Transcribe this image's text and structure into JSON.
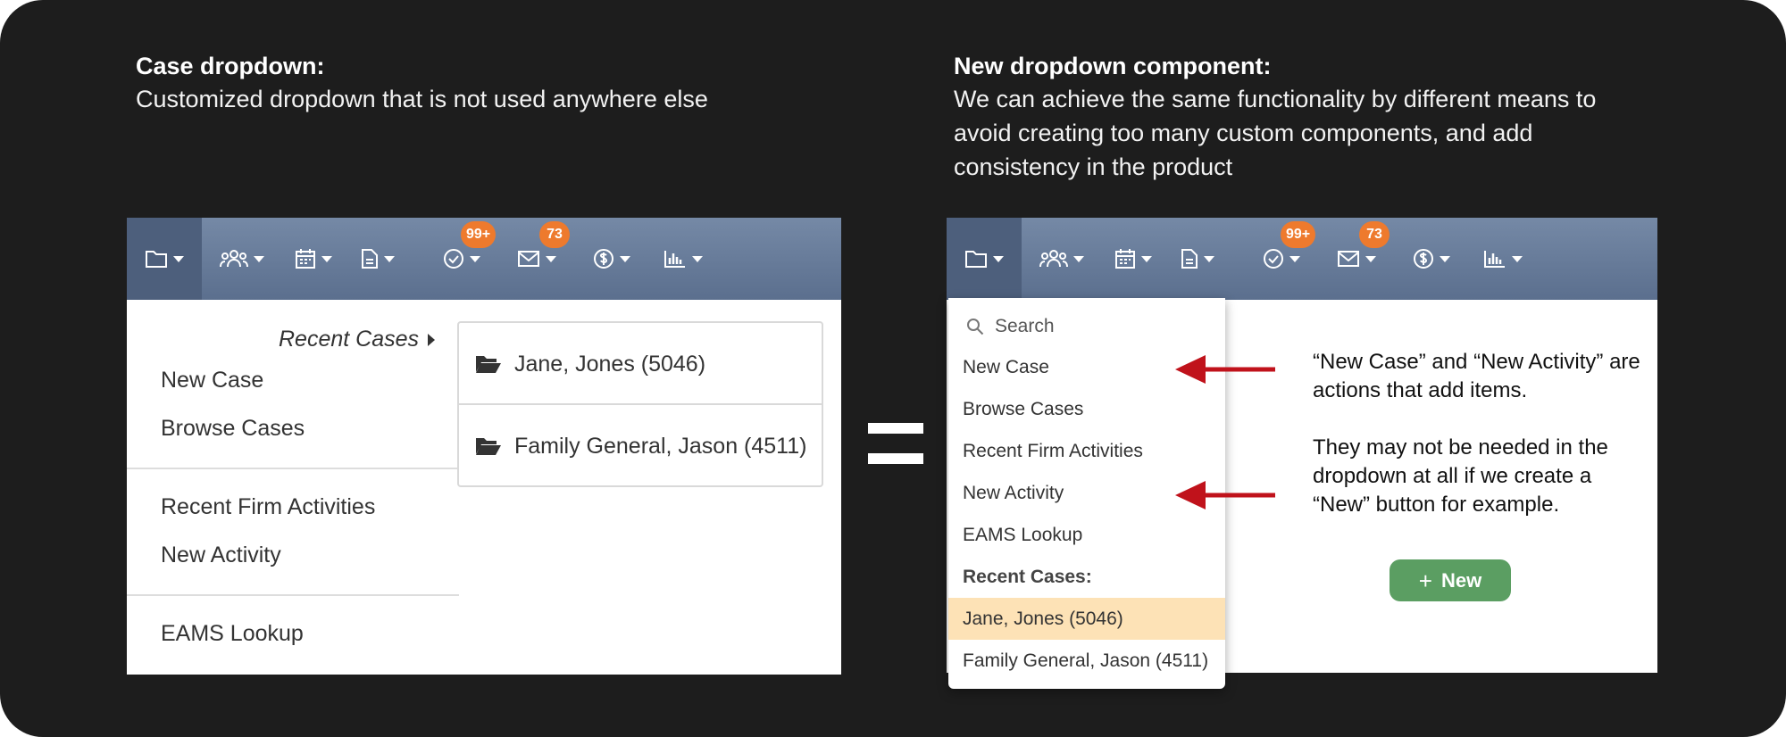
{
  "left": {
    "title": "Case dropdown:",
    "description": "Customized dropdown that is not used anywhere else",
    "menu": {
      "recent_cases": "Recent Cases",
      "items": [
        "New Case",
        "Browse Cases",
        "Recent Firm Activities",
        "New Activity",
        "EAMS Lookup"
      ],
      "submenu": [
        "Jane, Jones (5046)",
        "Family General, Jason (4511)"
      ]
    }
  },
  "right": {
    "title": "New dropdown component:",
    "description": "We can achieve the same functionality by different means to avoid creating too many custom components, and add consistency in the product",
    "menu": {
      "search_placeholder": "Search",
      "items": [
        "New Case",
        "Browse Cases",
        "Recent Firm Activities",
        "New Activity",
        "EAMS Lookup"
      ],
      "recent_header": "Recent Cases:",
      "recent": [
        "Jane, Jones (5046)",
        "Family General, Jason (4511)"
      ]
    },
    "annotation_1": "“New Case” and “New Activity” are actions that add items.",
    "annotation_2": "They may not be needed in the dropdown at all if we create a “New” button for example.",
    "new_button": "New"
  },
  "navbar": {
    "icons": [
      "folder-icon",
      "users-icon",
      "calendar-icon",
      "document-icon",
      "check-circle-icon",
      "mail-icon",
      "dollar-icon",
      "bar-chart-icon"
    ],
    "badges": {
      "tasks": "99+",
      "messages": "73"
    }
  },
  "colors": {
    "frame_bg": "#1d1d1d",
    "navbar": "#6a7e9c",
    "badge": "#ee7a2d",
    "arrow": "#c0121b",
    "highlight": "#fde2b6",
    "new_button": "#5b9e62"
  }
}
